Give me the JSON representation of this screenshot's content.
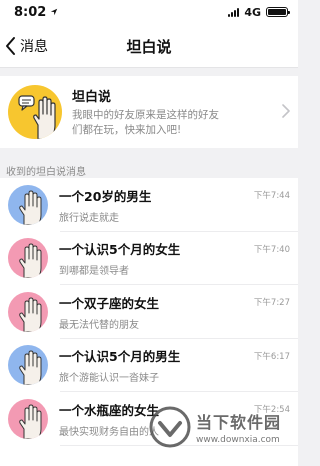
{
  "status_bar": {
    "time": "8:02",
    "network": "4G",
    "icons": [
      "location-arrow-icon",
      "signal-bars-icon",
      "battery-icon"
    ]
  },
  "nav": {
    "back_label": "消息",
    "title": "坦白说"
  },
  "feature": {
    "title": "坦白说",
    "description": "我眼中的好友原来是这样的好友们都在玩，快来加入吧!",
    "avatar_color": "#f7c62f"
  },
  "section_header": "收到的坦白说消息",
  "messages": [
    {
      "title": "一个20岁的男生",
      "subtitle": "旅行说走就走",
      "time": "下午7:44",
      "avatar": "blue",
      "avatar_color": "#8fb6ee"
    },
    {
      "title": "一个认识5个月的女生",
      "subtitle": "到哪都是领导者",
      "time": "下午7:40",
      "avatar": "pink",
      "avatar_color": "#f39ab3"
    },
    {
      "title": "一个双子座的女生",
      "subtitle": "最无法代替的朋友",
      "time": "下午7:27",
      "avatar": "pink",
      "avatar_color": "#f39ab3"
    },
    {
      "title": "一个认识5个月的男生",
      "subtitle": "旅个游能认识一沓妹子",
      "time": "下午6:17",
      "avatar": "blue",
      "avatar_color": "#8fb6ee"
    },
    {
      "title": "一个水瓶座的女生",
      "subtitle": "最快实现财务自由的人",
      "time": "下午2:54",
      "avatar": "pink",
      "avatar_color": "#f39ab3"
    }
  ],
  "watermark": {
    "text": "当下软件园",
    "url": "www.downxia.com"
  }
}
